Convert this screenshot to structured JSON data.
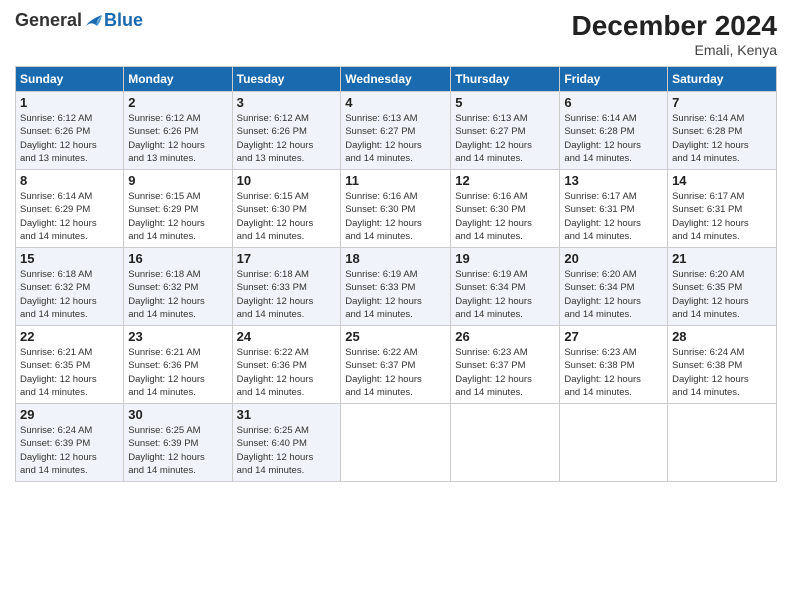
{
  "logo": {
    "general": "General",
    "blue": "Blue"
  },
  "title": "December 2024",
  "location": "Emali, Kenya",
  "headers": [
    "Sunday",
    "Monday",
    "Tuesday",
    "Wednesday",
    "Thursday",
    "Friday",
    "Saturday"
  ],
  "weeks": [
    [
      {
        "day": "1",
        "sunrise": "6:12 AM",
        "sunset": "6:26 PM",
        "daylight": "12 hours and 13 minutes."
      },
      {
        "day": "2",
        "sunrise": "6:12 AM",
        "sunset": "6:26 PM",
        "daylight": "12 hours and 13 minutes."
      },
      {
        "day": "3",
        "sunrise": "6:12 AM",
        "sunset": "6:26 PM",
        "daylight": "12 hours and 13 minutes."
      },
      {
        "day": "4",
        "sunrise": "6:13 AM",
        "sunset": "6:27 PM",
        "daylight": "12 hours and 14 minutes."
      },
      {
        "day": "5",
        "sunrise": "6:13 AM",
        "sunset": "6:27 PM",
        "daylight": "12 hours and 14 minutes."
      },
      {
        "day": "6",
        "sunrise": "6:14 AM",
        "sunset": "6:28 PM",
        "daylight": "12 hours and 14 minutes."
      },
      {
        "day": "7",
        "sunrise": "6:14 AM",
        "sunset": "6:28 PM",
        "daylight": "12 hours and 14 minutes."
      }
    ],
    [
      {
        "day": "8",
        "sunrise": "6:14 AM",
        "sunset": "6:29 PM",
        "daylight": "12 hours and 14 minutes."
      },
      {
        "day": "9",
        "sunrise": "6:15 AM",
        "sunset": "6:29 PM",
        "daylight": "12 hours and 14 minutes."
      },
      {
        "day": "10",
        "sunrise": "6:15 AM",
        "sunset": "6:30 PM",
        "daylight": "12 hours and 14 minutes."
      },
      {
        "day": "11",
        "sunrise": "6:16 AM",
        "sunset": "6:30 PM",
        "daylight": "12 hours and 14 minutes."
      },
      {
        "day": "12",
        "sunrise": "6:16 AM",
        "sunset": "6:30 PM",
        "daylight": "12 hours and 14 minutes."
      },
      {
        "day": "13",
        "sunrise": "6:17 AM",
        "sunset": "6:31 PM",
        "daylight": "12 hours and 14 minutes."
      },
      {
        "day": "14",
        "sunrise": "6:17 AM",
        "sunset": "6:31 PM",
        "daylight": "12 hours and 14 minutes."
      }
    ],
    [
      {
        "day": "15",
        "sunrise": "6:18 AM",
        "sunset": "6:32 PM",
        "daylight": "12 hours and 14 minutes."
      },
      {
        "day": "16",
        "sunrise": "6:18 AM",
        "sunset": "6:32 PM",
        "daylight": "12 hours and 14 minutes."
      },
      {
        "day": "17",
        "sunrise": "6:18 AM",
        "sunset": "6:33 PM",
        "daylight": "12 hours and 14 minutes."
      },
      {
        "day": "18",
        "sunrise": "6:19 AM",
        "sunset": "6:33 PM",
        "daylight": "12 hours and 14 minutes."
      },
      {
        "day": "19",
        "sunrise": "6:19 AM",
        "sunset": "6:34 PM",
        "daylight": "12 hours and 14 minutes."
      },
      {
        "day": "20",
        "sunrise": "6:20 AM",
        "sunset": "6:34 PM",
        "daylight": "12 hours and 14 minutes."
      },
      {
        "day": "21",
        "sunrise": "6:20 AM",
        "sunset": "6:35 PM",
        "daylight": "12 hours and 14 minutes."
      }
    ],
    [
      {
        "day": "22",
        "sunrise": "6:21 AM",
        "sunset": "6:35 PM",
        "daylight": "12 hours and 14 minutes."
      },
      {
        "day": "23",
        "sunrise": "6:21 AM",
        "sunset": "6:36 PM",
        "daylight": "12 hours and 14 minutes."
      },
      {
        "day": "24",
        "sunrise": "6:22 AM",
        "sunset": "6:36 PM",
        "daylight": "12 hours and 14 minutes."
      },
      {
        "day": "25",
        "sunrise": "6:22 AM",
        "sunset": "6:37 PM",
        "daylight": "12 hours and 14 minutes."
      },
      {
        "day": "26",
        "sunrise": "6:23 AM",
        "sunset": "6:37 PM",
        "daylight": "12 hours and 14 minutes."
      },
      {
        "day": "27",
        "sunrise": "6:23 AM",
        "sunset": "6:38 PM",
        "daylight": "12 hours and 14 minutes."
      },
      {
        "day": "28",
        "sunrise": "6:24 AM",
        "sunset": "6:38 PM",
        "daylight": "12 hours and 14 minutes."
      }
    ],
    [
      {
        "day": "29",
        "sunrise": "6:24 AM",
        "sunset": "6:39 PM",
        "daylight": "12 hours and 14 minutes."
      },
      {
        "day": "30",
        "sunrise": "6:25 AM",
        "sunset": "6:39 PM",
        "daylight": "12 hours and 14 minutes."
      },
      {
        "day": "31",
        "sunrise": "6:25 AM",
        "sunset": "6:40 PM",
        "daylight": "12 hours and 14 minutes."
      },
      null,
      null,
      null,
      null
    ]
  ],
  "labels": {
    "sunrise": "Sunrise:",
    "sunset": "Sunset:",
    "daylight": "Daylight:"
  }
}
